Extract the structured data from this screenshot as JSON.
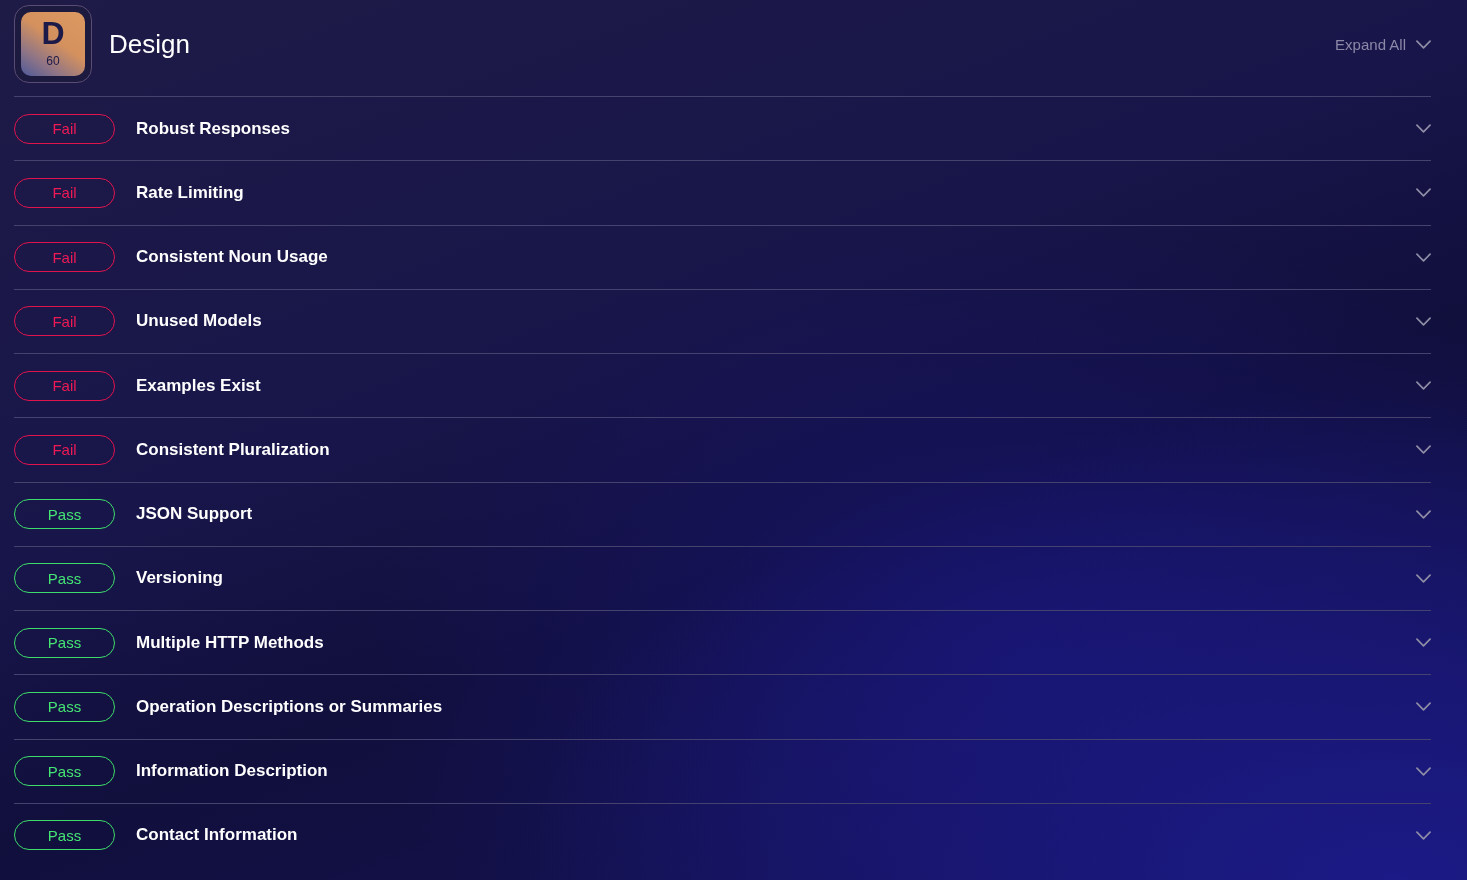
{
  "header": {
    "grade": {
      "letter": "D",
      "score": "60"
    },
    "title": "Design",
    "expand_all": "Expand All"
  },
  "checks": [
    {
      "kind": "fail",
      "status": "Fail",
      "title": "Robust Responses",
      "expanded": false
    },
    {
      "kind": "fail",
      "status": "Fail",
      "title": "Rate Limiting",
      "expanded": false
    },
    {
      "kind": "fail",
      "status": "Fail",
      "title": "Consistent Noun Usage",
      "expanded": false
    },
    {
      "kind": "fail",
      "status": "Fail",
      "title": "Unused Models",
      "expanded": false
    },
    {
      "kind": "fail",
      "status": "Fail",
      "title": "Examples Exist",
      "expanded": false
    },
    {
      "kind": "fail",
      "status": "Fail",
      "title": "Consistent Pluralization",
      "expanded": false
    },
    {
      "kind": "pass",
      "status": "Pass",
      "title": "JSON Support",
      "expanded": false
    },
    {
      "kind": "pass",
      "status": "Pass",
      "title": "Versioning",
      "expanded": false
    },
    {
      "kind": "pass",
      "status": "Pass",
      "title": "Multiple HTTP Methods",
      "expanded": false
    },
    {
      "kind": "pass",
      "status": "Pass",
      "title": "Operation Descriptions or Summaries",
      "expanded": false
    },
    {
      "kind": "pass",
      "status": "Pass",
      "title": "Information Description",
      "expanded": false
    },
    {
      "kind": "pass",
      "status": "Pass",
      "title": "Contact Information",
      "expanded": false
    }
  ]
}
